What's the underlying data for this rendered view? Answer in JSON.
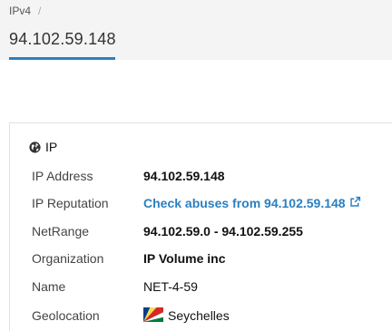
{
  "header": {
    "breadcrumb": "IPv4",
    "breadcrumb_separator": "/",
    "title": "94.102.59.148",
    "accent_color": "#2a7fc1"
  },
  "section": {
    "icon": "globe-icon",
    "title": "IP"
  },
  "rows": [
    {
      "label": "IP Address",
      "value": "94.102.59.148"
    },
    {
      "label": "IP Reputation",
      "value": "Check abuses from 94.102.59.148",
      "icon": "external-link-icon",
      "color": "#2a7fc1"
    },
    {
      "label": "NetRange",
      "value": "94.102.59.0 - 94.102.59.255"
    },
    {
      "label": "Organization",
      "value": "IP Volume inc"
    },
    {
      "label": "Name",
      "value": "NET-4-59"
    },
    {
      "label": "Geolocation",
      "value": "Seychelles",
      "icon": "seychelles-flag-icon"
    }
  ]
}
